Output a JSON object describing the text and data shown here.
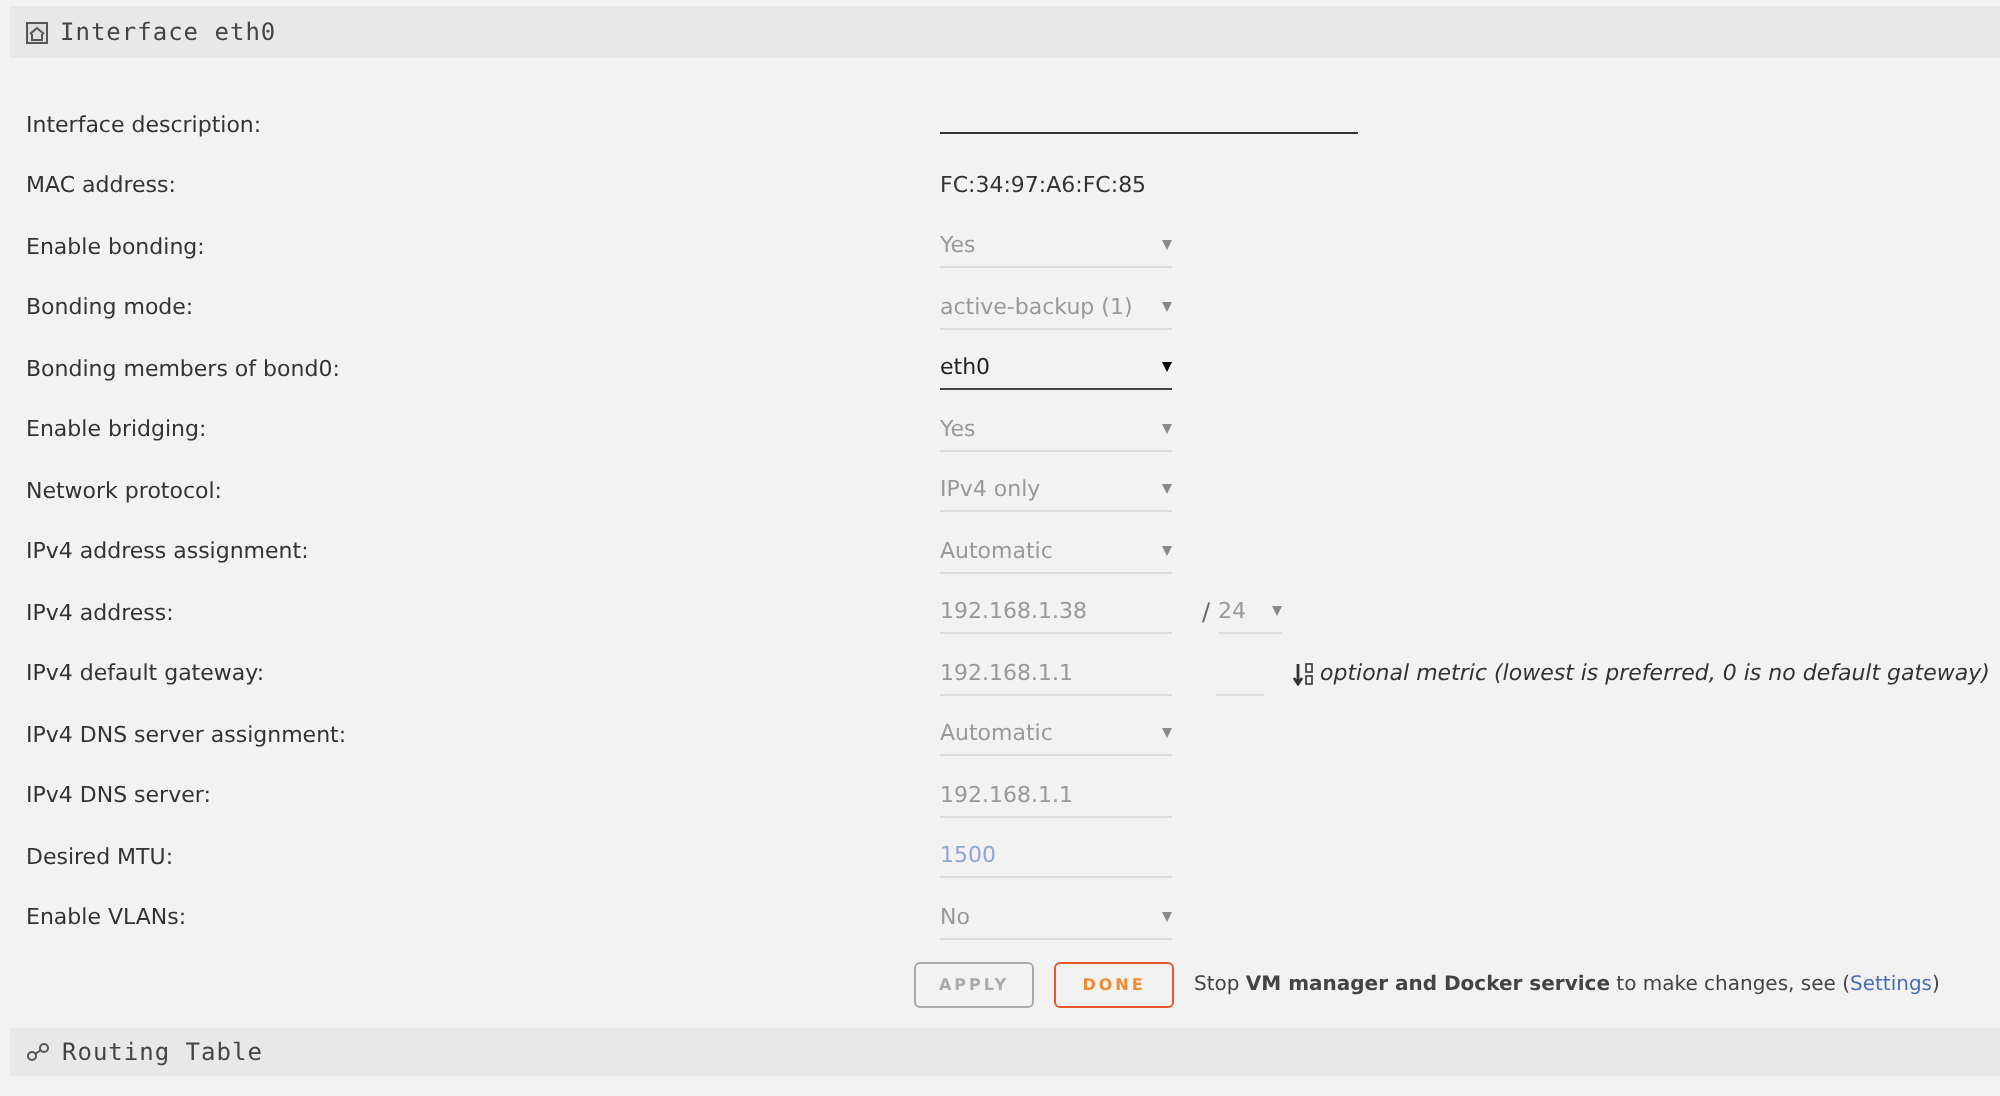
{
  "section": {
    "title": "Interface eth0"
  },
  "rows": [
    {
      "label": "Interface description:",
      "kind": "text"
    },
    {
      "label": "MAC address:",
      "kind": "static",
      "value": "FC:34:97:A6:FC:85"
    },
    {
      "label": "Enable bonding:",
      "kind": "select",
      "value": "Yes",
      "disabled": true
    },
    {
      "label": "Bonding mode:",
      "kind": "select",
      "value": "active-backup (1)",
      "disabled": true
    },
    {
      "label": "Bonding members of bond0:",
      "kind": "select",
      "value": "eth0",
      "disabled": false
    },
    {
      "label": "Enable bridging:",
      "kind": "select",
      "value": "Yes",
      "disabled": true
    },
    {
      "label": "Network protocol:",
      "kind": "select",
      "value": "IPv4 only",
      "disabled": true
    },
    {
      "label": "IPv4 address assignment:",
      "kind": "select",
      "value": "Automatic",
      "disabled": true
    },
    {
      "label": "IPv4 address:",
      "kind": "address",
      "value": "192.168.1.38",
      "separator": "/",
      "prefix": "24",
      "disabled": true
    },
    {
      "label": "IPv4 default gateway:",
      "kind": "gateway",
      "value": "192.168.1.1",
      "hint": "optional metric (lowest is preferred, 0 is no default gateway)",
      "disabled": true
    },
    {
      "label": "IPv4 DNS server assignment:",
      "kind": "select",
      "value": "Automatic",
      "disabled": true
    },
    {
      "label": "IPv4 DNS server:",
      "kind": "input",
      "value": "192.168.1.1",
      "disabled": true
    },
    {
      "label": "Desired MTU:",
      "kind": "input",
      "placeholder": "1500",
      "disabled": true
    },
    {
      "label": "Enable VLANs:",
      "kind": "select",
      "value": "No",
      "disabled": true
    }
  ],
  "buttons": [
    {
      "label": "APPLY",
      "kind": "apply",
      "disabled": true
    },
    {
      "label": "DONE",
      "kind": "done",
      "disabled": false
    }
  ],
  "notice": "Stop **VM manager and Docker service** to make changes, see (",
  "notice_link": "Settings",
  "notice_end": ")",
  "next_section": {
    "title": "Routing Table"
  }
}
